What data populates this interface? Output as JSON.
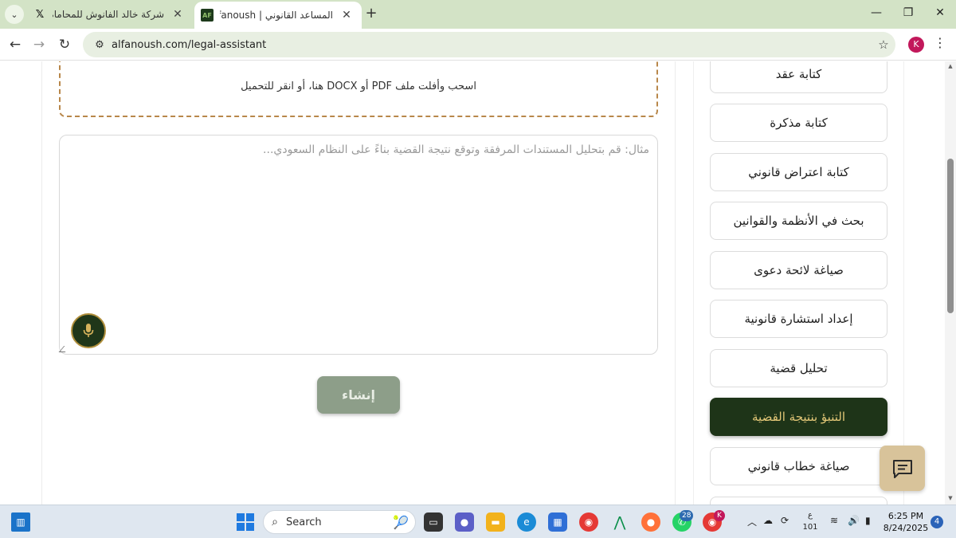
{
  "browser": {
    "tabs": [
      {
        "title": "شركة خالد الفانوش للمحاماة و الا",
        "favicon": "x-logo-icon",
        "active": false
      },
      {
        "title": "المساعد القانوني | Al-fanoush",
        "favicon": "alfanoush-favicon",
        "active": true
      }
    ],
    "url": "alfanoush.com/legal-assistant",
    "profile_initial": "K"
  },
  "upload": {
    "dropzone_text": "اسحب وأفلت ملف PDF أو DOCX هنا، أو انقر للتحميل"
  },
  "prompt": {
    "placeholder": "مثال: قم بتحليل المستندات المرفقة وتوقع نتيجة القضية بناءً على النظام السعودي..."
  },
  "create_button": "إنشاء",
  "sidebar": {
    "items": [
      {
        "label": "كتابة عقد",
        "active": false
      },
      {
        "label": "كتابة مذكرة",
        "active": false
      },
      {
        "label": "كتابة اعتراض قانوني",
        "active": false
      },
      {
        "label": "بحث في الأنظمة والقوانين",
        "active": false
      },
      {
        "label": "صياغة لائحة دعوى",
        "active": false
      },
      {
        "label": "إعداد استشارة قانونية",
        "active": false
      },
      {
        "label": "تحليل قضية",
        "active": false
      },
      {
        "label": "التنبؤ بنتيجة القضية",
        "active": true
      },
      {
        "label": "صياغة خطاب قانوني",
        "active": false
      }
    ]
  },
  "taskbar": {
    "search_label": "Search",
    "whatsapp_badge": "28",
    "chrome_badge": "K",
    "weather_top": "ع",
    "weather_bottom": "101",
    "time": "6:25 PM",
    "date": "8/24/2025",
    "notifications": "4"
  },
  "colors": {
    "accent_dark_green": "#1e3418",
    "accent_gold": "#e3c777",
    "dropzone_border": "#b8874a",
    "create_button": "#8d9e89",
    "chat_button": "#d8c39a"
  }
}
